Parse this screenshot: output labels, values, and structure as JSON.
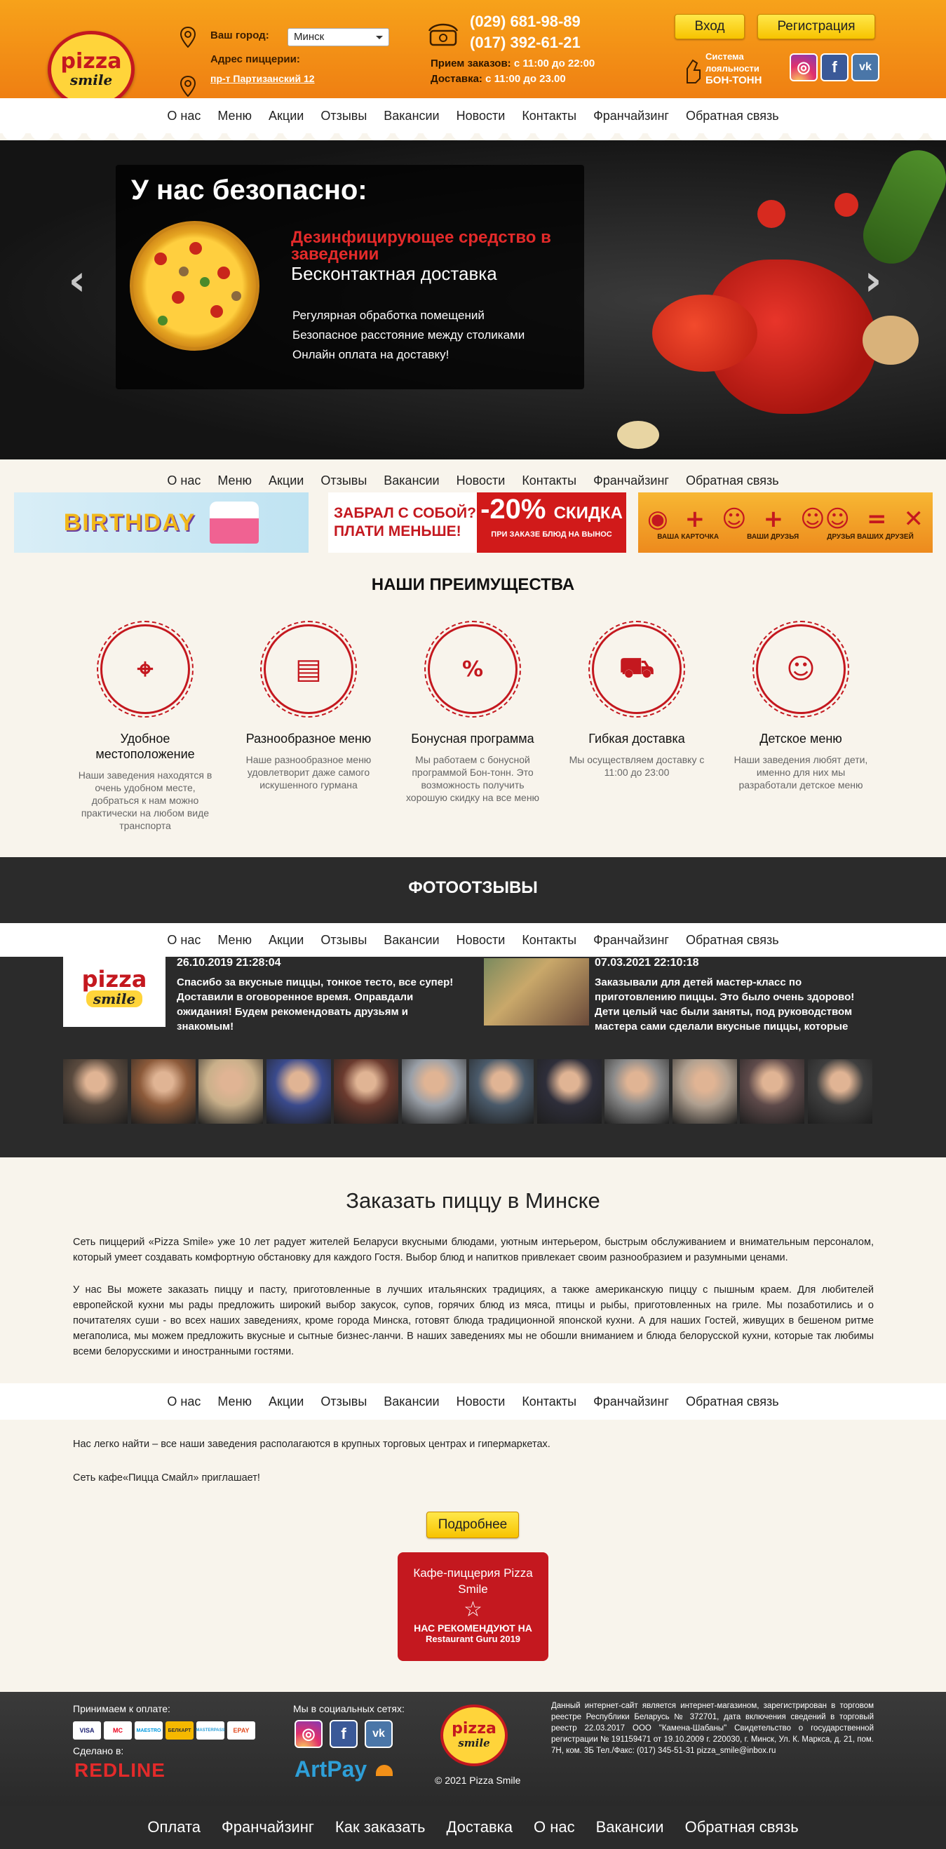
{
  "header": {
    "logo_top": "pizza",
    "logo_bottom": "smile",
    "city_label": "Ваш город:",
    "city_value": "Минск",
    "address_label": "Адрес пиццерии:",
    "address_value": "пр-т Партизанский 12",
    "phone_1": "(029) 681-98-89",
    "phone_2": "(017) 392-61-21",
    "orders_label": "Прием заказов:",
    "orders_hours": "с 11:00 до 22:00",
    "delivery_label": "Доставка:",
    "delivery_hours": "с 11:00 до 23.00",
    "login": "Вход",
    "register": "Регистрация",
    "loyalty_line1": "Система",
    "loyalty_line2": "лояльности",
    "loyalty_line3": "БОН-ТОНН",
    "social_icons": [
      "instagram-icon",
      "facebook-icon",
      "vk-icon"
    ]
  },
  "nav": [
    "О нас",
    "Меню",
    "Акции",
    "Отзывы",
    "Вакансии",
    "Новости",
    "Контакты",
    "Франчайзинг",
    "Обратная связь"
  ],
  "hero": {
    "title": "У нас безопасно:",
    "red_text": "Дезинфицирующее средство в заведении",
    "white_text": "Бесконтактная доставка",
    "items": [
      "Регулярная обработка помещений",
      "Безопасное расстояние между столиками",
      "Онлайн оплата на доставку!"
    ]
  },
  "promo": {
    "banner1": "BIRTHDAY",
    "banner2_line1": "ЗАБРАЛ С СОБОЙ?",
    "banner2_line2": "ПЛАТИ МЕНЬШЕ!",
    "banner2_pct": "-20%",
    "banner2_word": "СКИДКА",
    "banner2_note": "ПРИ ЗАКАЗЕ БЛЮД НА ВЫНОС",
    "banner3_labels": [
      "ВАША КАРТОЧКА",
      "ВАШИ ДРУЗЬЯ",
      "ДРУЗЬЯ ВАШИХ ДРУЗЕЙ"
    ]
  },
  "advantages": {
    "title": "НАШИ ПРЕИМУЩЕСТВА",
    "items": [
      {
        "title": "Удобное местоположение",
        "desc": "Наши заведения находятся в очень удобном месте, добраться к нам можно практически на любом виде транспорта",
        "icon": "location-pin-icon"
      },
      {
        "title": "Разнообразное меню",
        "desc": "Наше разнообразное меню удовлетворит даже самого искушенного гурмана",
        "icon": "menu-card-icon"
      },
      {
        "title": "Бонусная программа",
        "desc": "Мы работаем с бонусной программой Бон-тонн. Это возможность получить хорошую скидку на все меню",
        "icon": "discount-card-icon"
      },
      {
        "title": "Гибкая доставка",
        "desc": "Мы осуществляем доставку с 11:00 до 23:00",
        "icon": "delivery-truck-icon"
      },
      {
        "title": "Детское меню",
        "desc": "Наши заведения любят дети, именно для них мы разработали детское меню",
        "icon": "kid-balloon-icon"
      }
    ]
  },
  "photos": {
    "title": "ФОТООТЗЫВЫ",
    "reviews": [
      {
        "date": "26.10.2019 21:28:04",
        "text": "Спасибо за вкусные пиццы, тонкое тесто, все супер! Доставили в оговоренное время. Оправдали ожидания! Будем рекомендовать друзьям и знакомым!"
      },
      {
        "date": "07.03.2021 22:10:18",
        "text": "Заказывали для детей мастер-класс по приготовлению пиццы. Это было очень здорово! Дети целый час были заняты, под руководством мастера сами сделали вкусные пиццы, которые"
      }
    ],
    "thumb_count": 12
  },
  "seo": {
    "title": "Заказать пиццу в Минске",
    "p1": "Сеть пиццерий «Pizza Smile» уже 10 лет радует жителей Беларуси вкусными блюдами, уютным интерьером, быстрым обслуживанием и внимательным персоналом, который умеет создавать комфортную обстановку для каждого Гостя. Выбор блюд и напитков привлекает своим разнообразием и разумными ценами.",
    "p2": "У нас Вы можете заказать пиццу и пасту, приготовленные в лучших итальянских традициях, а также американскую пиццу с пышным краем. Для любителей европейской кухни мы рады предложить широкий выбор закусок, супов, горячих блюд из мяса, птицы и рыбы, приготовленных на гриле. Мы позаботились и о почитателях суши - во всех наших заведениях, кроме города Минска, готовят блюда традиционной японской кухни. А для наших Гостей, живущих в бешеном ритме мегаполиса, мы можем предложить вкусные и сытные бизнес-ланчи. В наших заведениях мы не обошли вниманием и блюда белорусской кухни, которые так любимы всеми белорусскими и иностранными гостями.",
    "p3": "Нас легко найти – все наши заведения располагаются в крупных торговых центрах и гипермаркетах.",
    "p4": "Сеть кафе«Пицца Смайл» приглашает!",
    "more": "Подробнее",
    "badge_line1": "Кафе-пиццерия Pizza",
    "badge_line2": "Smile",
    "badge_rec": "НАС РЕКОМЕНДУЮТ НА",
    "badge_src": "Restaurant Guru 2019"
  },
  "footer": {
    "pay_label": "Принимаем к оплате:",
    "cards": [
      "VISA",
      "MC",
      "MAESTRO",
      "БЕЛКАРТ",
      "MASTERPASS",
      "EPAY"
    ],
    "made_label": "Сделано в:",
    "made_by": "REDLINE",
    "social_label": "Мы в социальных сетях:",
    "artpay": "ArtPay",
    "copyright": "© 2021 Pizza Smile",
    "legal": "Данный интернет-сайт является интернет-магазином, зарегистрирован в торговом реестре Республики Беларусь № 372701, дата включения сведений в торговый реестр 22.03.2017 ООО \"Камена-Шабаны\" Свидетельство о государственной регистрации № 191159471 от 19.10.2009 г. 220030, г. Минск, Ул. К. Маркса, д. 21, пом. 7Н, ком. 3Б Тел./Факс: (017) 345-51-31 pizza_smile@inbox.ru",
    "bottom_nav": [
      "Оплата",
      "Франчайзинг",
      "Как заказать",
      "Доставка",
      "О нас",
      "Вакансии",
      "Обратная связь"
    ]
  },
  "colors": {
    "brand_red": "#c4181f",
    "header_orange": "#f29018",
    "button_yellow": "#f7c300"
  }
}
